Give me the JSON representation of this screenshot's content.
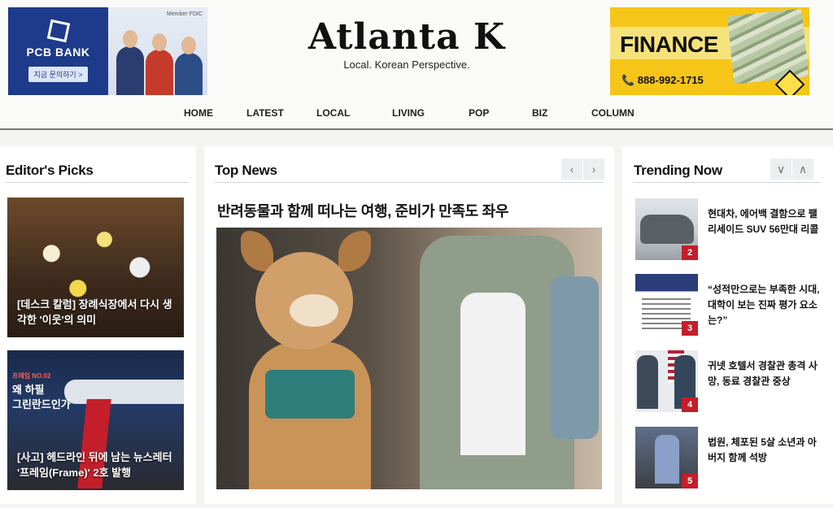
{
  "site": {
    "title": "Atlanta K",
    "tagline": "Local. Korean Perspective."
  },
  "ads": {
    "left": {
      "brand": "PCB BANK",
      "cta": "지금 문의하기 >",
      "fdic": "Member FDIC"
    },
    "right": {
      "headline": "FINANCE",
      "phone": "📞 888-992-1715"
    }
  },
  "nav": {
    "items": [
      "HOME",
      "LATEST",
      "LOCAL",
      "LIVING",
      "POP",
      "BIZ",
      "COLUMN"
    ]
  },
  "editors_picks": {
    "heading": "Editor's Picks",
    "items": [
      {
        "caption": "[데스크 칼럼] 장례식장에서 다시 생각한 '이웃'의 의미"
      },
      {
        "tag": "프레임 NO.02",
        "overlay": "왜 하필\n그린란드인가",
        "caption": "[사고] 헤드라인 뒤에 남는 뉴스레터 '프레임(Frame)' 2호 발행"
      }
    ]
  },
  "top_news": {
    "heading": "Top News",
    "prev": "‹",
    "next": "›",
    "headline": "반려동물과 함께 떠나는 여행, 준비가 만족도 좌우"
  },
  "trending": {
    "heading": "Trending Now",
    "up": "∨",
    "down": "∧",
    "items": [
      {
        "rank": "2",
        "title": "현대차, 에어백 결함으로 팰리세이드 SUV 56만대 리콜"
      },
      {
        "rank": "3",
        "title": "“성적만으로는 부족한 시대, 대학이 보는 진짜 평가 요소는?”"
      },
      {
        "rank": "4",
        "title": "귀넷 호텔서 경찰관 총격 사망, 동료 경찰관 중상"
      },
      {
        "rank": "5",
        "title": "법원, 체포된 5살 소년과 아버지 함께 석방"
      }
    ]
  },
  "colors": {
    "accent_red": "#c41e2a",
    "bank_blue": "#1e3a8a",
    "finance_yellow": "#f5c518"
  }
}
